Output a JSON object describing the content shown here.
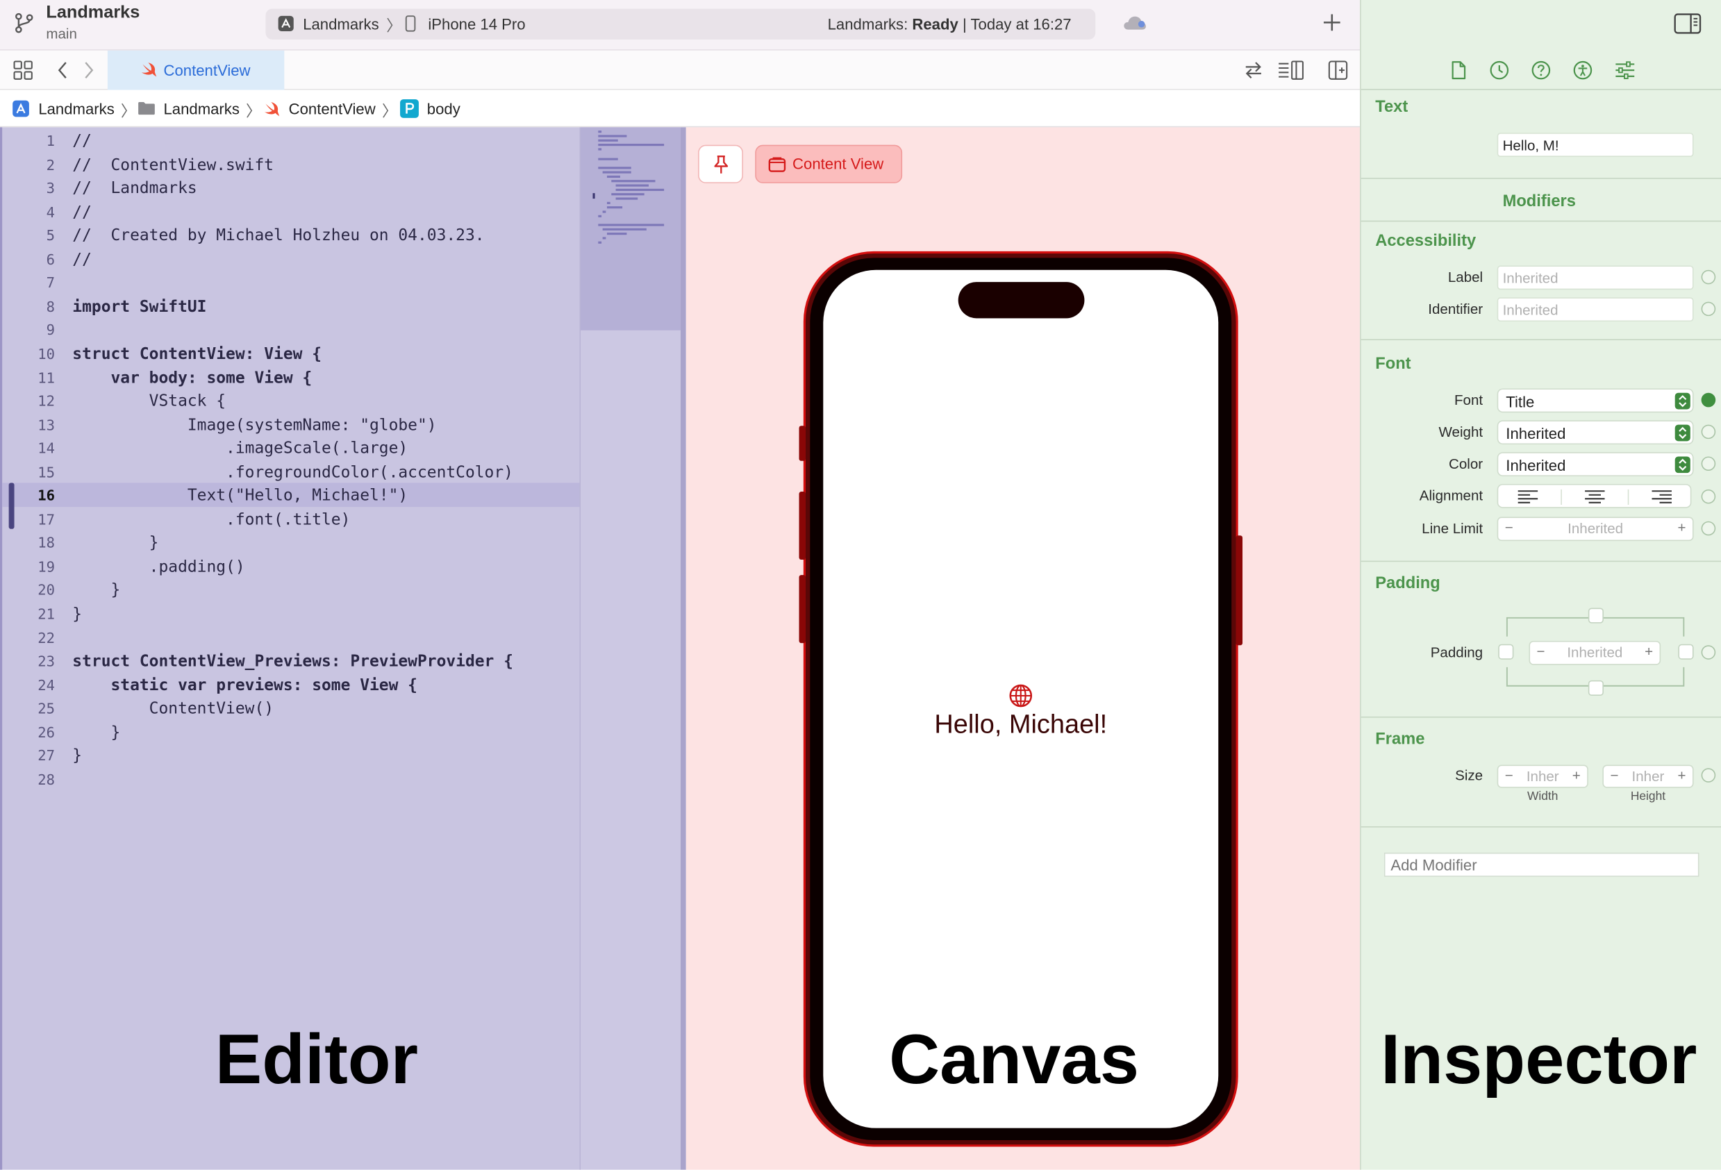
{
  "toolbar": {
    "project": "Landmarks",
    "branch": "main",
    "scheme_app": "Landmarks",
    "scheme_device": "iPhone 14 Pro",
    "status_prefix": "Landmarks: ",
    "status_state": "Ready",
    "status_time": " | Today at 16:27",
    "add_icon": "plus-icon"
  },
  "tab": {
    "label": "ContentView"
  },
  "breadcrumb": [
    "Landmarks",
    "Landmarks",
    "ContentView",
    "body"
  ],
  "editor": {
    "current_line": 16,
    "lines": [
      "//",
      "//  ContentView.swift",
      "//  Landmarks",
      "//",
      "//  Created by Michael Holzheu on 04.03.23.",
      "//",
      "",
      "import SwiftUI",
      "",
      "struct ContentView: View {",
      "    var body: some View {",
      "        VStack {",
      "            Image(systemName: \"globe\")",
      "                .imageScale(.large)",
      "                .foregroundColor(.accentColor)",
      "            Text(\"Hello, Michael!\")",
      "                .font(.title)",
      "        }",
      "        .padding()",
      "    }",
      "}",
      "",
      "struct ContentView_Previews: PreviewProvider {",
      "    static var previews: some View {",
      "        ContentView()",
      "    }",
      "}",
      ""
    ]
  },
  "canvas": {
    "content_view_label": "Content View",
    "preview_text": "Hello, Michael!"
  },
  "inspector": {
    "text_header": "Text",
    "text_value": "Hello, M!",
    "modifiers_header": "Modifiers",
    "accessibility_header": "Accessibility",
    "label_label": "Label",
    "label_value": "Inherited",
    "identifier_label": "Identifier",
    "identifier_value": "Inherited",
    "font_header": "Font",
    "font_label": "Font",
    "font_value": "Title",
    "weight_label": "Weight",
    "weight_value": "Inherited",
    "color_label": "Color",
    "color_value": "Inherited",
    "alignment_label": "Alignment",
    "line_limit_label": "Line Limit",
    "line_limit_value": "Inherited",
    "padding_header": "Padding",
    "padding_label": "Padding",
    "padding_value": "Inherited",
    "frame_header": "Frame",
    "size_label": "Size",
    "width_value": "Inher",
    "height_value": "Inher",
    "width_caption": "Width",
    "height_caption": "Height",
    "add_modifier_placeholder": "Add Modifier"
  },
  "annotations": {
    "editor": "Editor",
    "canvas": "Canvas",
    "inspector": "Inspector"
  },
  "colors": {
    "editor_bg": "#c9c5e1",
    "canvas_bg": "#fde3e3",
    "inspector_bg": "#e6f2e4",
    "accent": "#2a6bd8"
  }
}
